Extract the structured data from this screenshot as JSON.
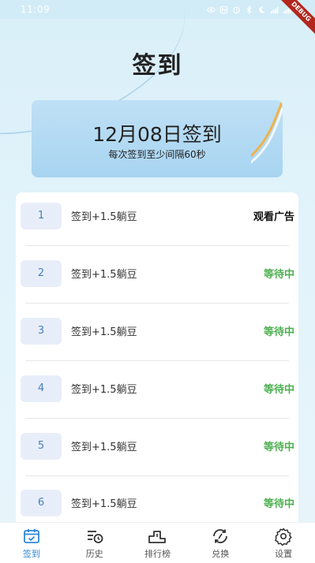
{
  "status_bar": {
    "time": "11:09",
    "debug_label": "DEBUG"
  },
  "header": {
    "title": "签到"
  },
  "date_card": {
    "date_text": "12月08日签到",
    "subtitle": "每次签到至少间隔60秒"
  },
  "checkin_list": [
    {
      "index": "1",
      "label": "签到+1.5躺豆",
      "action": "观看广告",
      "action_type": "ad"
    },
    {
      "index": "2",
      "label": "签到+1.5躺豆",
      "action": "等待中",
      "action_type": "wait"
    },
    {
      "index": "3",
      "label": "签到+1.5躺豆",
      "action": "等待中",
      "action_type": "wait"
    },
    {
      "index": "4",
      "label": "签到+1.5躺豆",
      "action": "等待中",
      "action_type": "wait"
    },
    {
      "index": "5",
      "label": "签到+1.5躺豆",
      "action": "等待中",
      "action_type": "wait"
    },
    {
      "index": "6",
      "label": "签到+1.5躺豆",
      "action": "等待中",
      "action_type": "wait"
    }
  ],
  "colors": {
    "accent": "#2f87d8",
    "wait": "#4caf50",
    "card_bg": "#a8d4f1"
  },
  "bottom_nav": {
    "items": [
      {
        "label": "签到",
        "icon": "calendar-check-icon",
        "active": true
      },
      {
        "label": "历史",
        "icon": "history-icon",
        "active": false
      },
      {
        "label": "排行榜",
        "icon": "leaderboard-icon",
        "active": false
      },
      {
        "label": "兑换",
        "icon": "exchange-icon",
        "active": false
      },
      {
        "label": "设置",
        "icon": "gear-icon",
        "active": false
      }
    ]
  }
}
